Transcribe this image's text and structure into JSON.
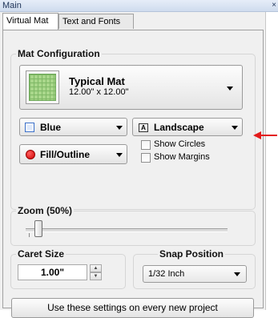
{
  "window": {
    "title": "Main",
    "close_glyph": "×"
  },
  "tabs": [
    {
      "label": "Virtual Mat",
      "active": true
    },
    {
      "label": "Text and Fonts",
      "active": false
    }
  ],
  "mat_configuration": {
    "legend": "Mat Configuration",
    "mat_name": "Typical Mat",
    "mat_size": "12.00\" x 12.00\"",
    "mat_icon": "green-grid-mat-icon"
  },
  "color_select": {
    "value": "Blue",
    "icon": "blue-square-icon",
    "accent": "#3a6fc9"
  },
  "orientation_select": {
    "value": "Landscape",
    "icon_glyph": "A",
    "icon": "landscape-icon"
  },
  "fill_select": {
    "value": "Fill/Outline",
    "icon": "red-dot-icon",
    "accent": "#d00000"
  },
  "checkboxes": [
    {
      "label": "Show Circles",
      "checked": false
    },
    {
      "label": "Show Margins",
      "checked": false
    }
  ],
  "zoom": {
    "legend": "Zoom (50%)",
    "level_percent": 50
  },
  "caret_size": {
    "legend": "Caret Size",
    "value": "1.00\""
  },
  "snap_position": {
    "legend": "Snap Position",
    "value": "1/32 Inch"
  },
  "apply_button": {
    "label": "Use these settings on every new project"
  },
  "annotation": {
    "color": "#e31b1b",
    "icon": "red-arrow-icon"
  }
}
